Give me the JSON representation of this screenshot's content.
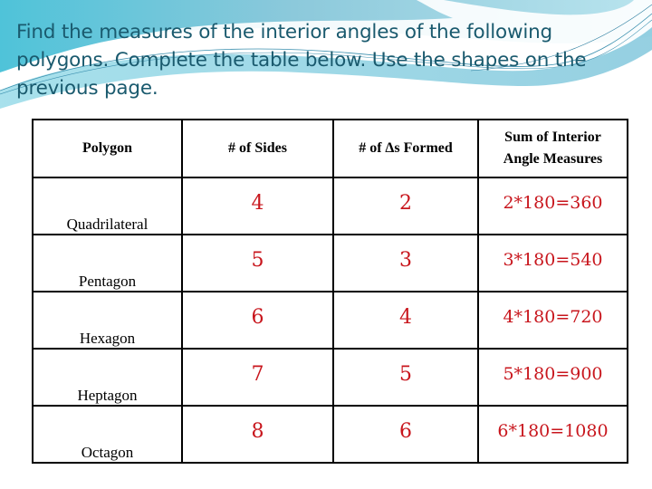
{
  "slide": {
    "instructions": "Find the measures of the interior angles of the following polygons. Complete the table below. Use the shapes on the previous page.",
    "colors": {
      "title_text": "#1a5a6e",
      "answer_text": "#c8161d",
      "swoosh_dark": "#5bbfd6",
      "swoosh_light": "#a9dde9"
    }
  },
  "table": {
    "headers": {
      "polygon": "Polygon",
      "sides": "# of Sides",
      "triangles_prefix": "# of ",
      "triangles_symbol": "∆",
      "triangles_suffix": "s Formed",
      "sum_line1": "Sum of Interior",
      "sum_line2": "Angle Measures"
    },
    "rows": [
      {
        "polygon": "Quadrilateral",
        "sides": "4",
        "triangles": "2",
        "sum": "2*180=360"
      },
      {
        "polygon": "Pentagon",
        "sides": "5",
        "triangles": "3",
        "sum": "3*180=540"
      },
      {
        "polygon": "Hexagon",
        "sides": "6",
        "triangles": "4",
        "sum": "4*180=720"
      },
      {
        "polygon": "Heptagon",
        "sides": "7",
        "triangles": "5",
        "sum": "5*180=900"
      },
      {
        "polygon": "Octagon",
        "sides": "8",
        "triangles": "6",
        "sum": "6*180=1080"
      }
    ]
  }
}
